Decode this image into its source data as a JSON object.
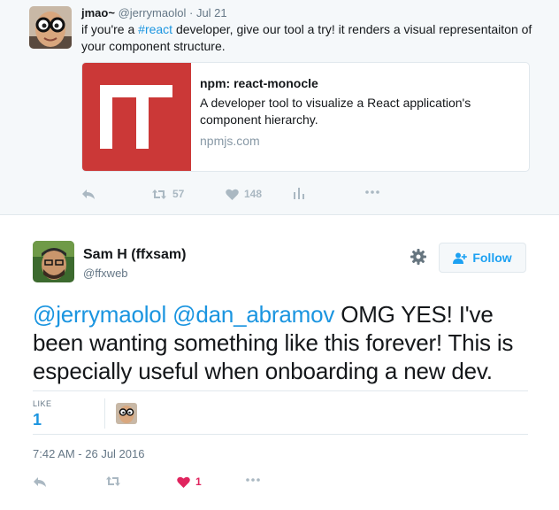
{
  "parent_tweet": {
    "name": "jmao~",
    "handle": "@jerrymaolol",
    "separator": "·",
    "date": "Jul 21",
    "text_before": "if you're a ",
    "hashtag": "#react",
    "text_after": " developer, give our tool a try! it renders a visual representaiton of your component structure.",
    "card": {
      "title": "npm: react-monocle",
      "description": "A developer tool to visualize a React application's component hierarchy.",
      "domain": "npmjs.com",
      "brand_color": "#cb3837"
    },
    "actions": {
      "retweet_count": "57",
      "like_count": "148"
    }
  },
  "main_tweet": {
    "name": "Sam H (ffxsam)",
    "handle": "@ffxweb",
    "follow_label": "Follow",
    "mention_1": "@jerrymaolol",
    "mention_2": "@dan_abramov",
    "text": " OMG YES! I've been wanting something like this forever! This is especially useful when onboarding a new dev.",
    "stats": {
      "like_label": "LIKE",
      "like_count": "1"
    },
    "timestamp": "7:42 AM - 26 Jul 2016",
    "actions": {
      "like_count": "1"
    }
  },
  "icons": {
    "reply": "reply-icon",
    "retweet": "retweet-icon",
    "like": "heart-icon",
    "analytics": "analytics-icon",
    "more": "more-icon",
    "gear": "gear-icon",
    "follow": "add-user-icon"
  },
  "colors": {
    "link": "#1b95e0",
    "like_active": "#e0245e",
    "action_gray": "#aab8c2"
  }
}
